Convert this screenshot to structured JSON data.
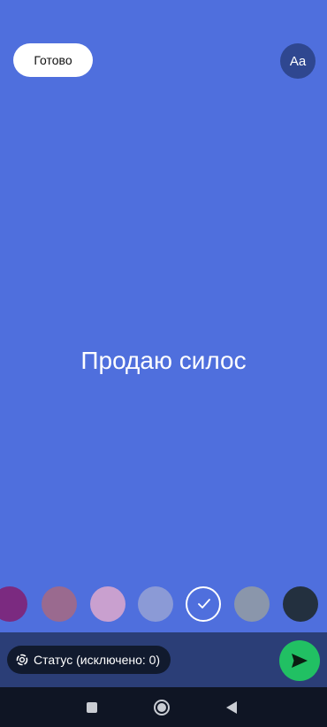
{
  "header": {
    "done_label": "Готово",
    "font_label": "Aa"
  },
  "status": {
    "text": "Продаю силос",
    "background_color": "#4f6fdd"
  },
  "palette": {
    "colors": [
      "#7b2a80",
      "#9a6a8f",
      "#c9a0cf",
      "#8b9ad6",
      "#4f6fdd",
      "#8a96ab",
      "#23303f"
    ],
    "selected_index": 4
  },
  "footer": {
    "privacy_label": "Статус (исключено: 0)",
    "privacy_icon": "status-ring-icon",
    "send_icon": "send-icon",
    "send_color": "#21c063"
  },
  "nav": {
    "recents_icon": "square-icon",
    "home_icon": "circle-icon",
    "back_icon": "triangle-back-icon"
  }
}
